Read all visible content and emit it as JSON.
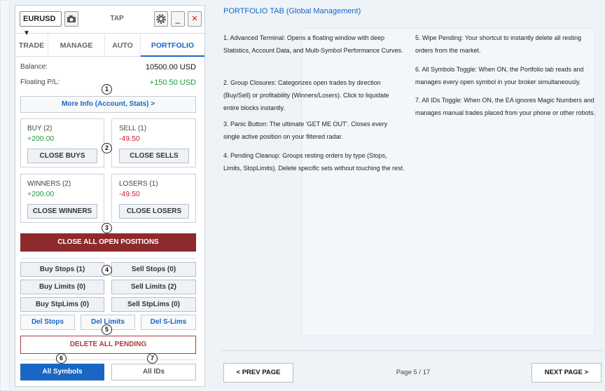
{
  "header": {
    "symbol": "EURUSD",
    "title": "TAP",
    "minimize_label": "_",
    "close_label": "×",
    "camera_icon": "camera-icon",
    "settings_icon": "gear-icon"
  },
  "tabs": [
    {
      "label": "TRADE",
      "active": false
    },
    {
      "label": "MANAGE",
      "active": false
    },
    {
      "label": "AUTO",
      "active": false
    },
    {
      "label": "PORTFOLIO",
      "active": true
    }
  ],
  "account": {
    "balance_label": "Balance:",
    "balance_value": "10500.00 USD",
    "floating_label": "Floating P/L:",
    "floating_value": "+150.50 USD"
  },
  "more_info_label": "More Info (Account, Stats) >",
  "groups": {
    "buy": {
      "label": "BUY (2)",
      "value": "+200.00",
      "button": "CLOSE BUYS"
    },
    "sell": {
      "label": "SELL (1)",
      "value": "-49.50",
      "button": "CLOSE SELLS"
    },
    "winners": {
      "label": "WINNERS (2)",
      "value": "+200.00",
      "button": "CLOSE WINNERS"
    },
    "losers": {
      "label": "LOSERS (1)",
      "value": "-49.50",
      "button": "CLOSE LOSERS"
    }
  },
  "close_all_label": "CLOSE ALL OPEN POSITIONS",
  "pending": {
    "buy_stops": "Buy Stops (1)",
    "sell_stops": "Sell Stops (0)",
    "buy_limits": "Buy Limits (0)",
    "sell_limits": "Sell Limits (2)",
    "buy_stplims": "Buy StpLims (0)",
    "sell_stplims": "Sell StpLims (0)",
    "del_stops": "Del Stops",
    "del_limits": "Del Limits",
    "del_slims": "Del S-Lims",
    "delete_all": "DELETE ALL PENDING"
  },
  "toggles": {
    "all_symbols": "All Symbols",
    "all_ids": "All IDs"
  },
  "markers": [
    "1",
    "2",
    "3",
    "4",
    "5",
    "6",
    "7"
  ],
  "tutorial": {
    "title": "PORTFOLIO TAB (Global Management)",
    "items": [
      "1. Advanced Terminal: Opens a floating window with deep Statistics, Account Data, and Multi-Symbol Performance Curves.",
      "2. Group Closures: Categorizes open trades by direction (Buy/Sell) or profitability (Winners/Losers). Click to liquidate entire blocks instantly.",
      "3. Panic Button: The ultimate 'GET ME OUT'. Closes every single active position on your filtered radar.",
      "4. Pending Cleanup: Groups resting orders by type (Stops, Limits, StopLimits). Delete specific sets without touching the rest.",
      "5. Wipe Pending: Your shortcut to instantly delete all resting orders from the market.",
      "6. All Symbols Toggle: When ON, the Portfolio tab reads and manages every open symbol in your broker simultaneously.",
      "7. All IDs Toggle: When ON, the EA ignores Magic Numbers and manages manual trades placed from your phone or other robots."
    ]
  },
  "navigation": {
    "prev_label": "< PREV PAGE",
    "page_label": "Page 5 / 17",
    "next_label": "NEXT PAGE >"
  },
  "colors": {
    "accent": "#1a66c4",
    "danger_bg": "#8c2a2e",
    "positive": "#1e9a3a",
    "negative": "#c8202c",
    "toggle_on": "#1a66c4"
  }
}
